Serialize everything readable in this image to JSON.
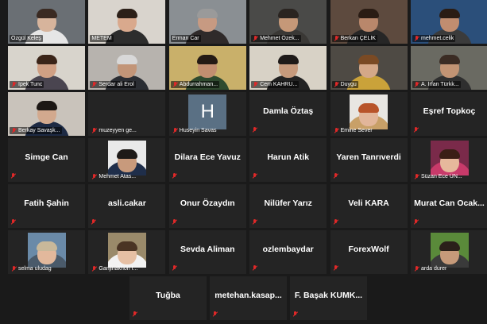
{
  "meeting": {
    "participants": [
      {
        "name": "Özgül Keleş",
        "tag": "Özgül Keleş",
        "video": true,
        "muted": false,
        "palette": [
          "#6a6f74",
          "#d7b49c",
          "#3a2a22",
          "#e6e6e6"
        ]
      },
      {
        "name": "METEM",
        "tag": "METEM",
        "video": true,
        "muted": false,
        "speaking": true,
        "palette": [
          "#d9d4cd",
          "#d9a98d",
          "#2c2018",
          "#2d2d2d"
        ]
      },
      {
        "name": "Erman Car",
        "tag": "Erman Car",
        "video": true,
        "muted": false,
        "palette": [
          "#8a8f93",
          "#c79a82",
          "#9a9a9a",
          "#2f2a2a"
        ]
      },
      {
        "name": "Mehmet Özek",
        "tag": "Mehmet Özek...",
        "video": true,
        "muted": true,
        "palette": [
          "#4a4a48",
          "#c59878",
          "#2a2420",
          "#3a3835"
        ]
      },
      {
        "name": "Berkan ÇELİK",
        "tag": "Berkan ÇELİK",
        "video": true,
        "muted": true,
        "palette": [
          "#5d4a3e",
          "#b9876b",
          "#2a1c14",
          "#262626"
        ]
      },
      {
        "name": "mehmet.celik",
        "tag": "mehmet.celik",
        "video": true,
        "muted": true,
        "palette": [
          "#2b4f7a",
          "#c08d70",
          "#2a1c14",
          "#3b3b3b"
        ]
      },
      {
        "name": "Ipek Tunc",
        "tag": "Ipek Tunc",
        "video": true,
        "muted": true,
        "palette": [
          "#d8d4cc",
          "#d0a084",
          "#3a2418",
          "#4a4550"
        ]
      },
      {
        "name": "Serdar ali Erol",
        "tag": "Serdar ali Erol",
        "video": true,
        "muted": true,
        "palette": [
          "#b7b3ae",
          "#c29578",
          "#d8d8d8",
          "#2a2d33"
        ]
      },
      {
        "name": "Abdurrahman",
        "tag": "Abdurrahman...",
        "video": true,
        "muted": true,
        "palette": [
          "#c9b06a",
          "#c28e70",
          "#241a14",
          "#2f4a2f"
        ]
      },
      {
        "name": "Cem KAHRU",
        "tag": "Cem KAHRU...",
        "video": true,
        "muted": true,
        "palette": [
          "#d8d2c6",
          "#c69a7c",
          "#1e1a18",
          "#222222"
        ]
      },
      {
        "name": "Duygu",
        "tag": "Duygu",
        "video": true,
        "muted": true,
        "palette": [
          "#4e4a44",
          "#d4a888",
          "#7a4a24",
          "#caa23a"
        ]
      },
      {
        "name": "A. İrfan Türkk",
        "tag": "A. İrfan Türkk...",
        "video": true,
        "muted": true,
        "palette": [
          "#6a6a62",
          "#c29474",
          "#3b2c24",
          "#2f2f2f"
        ]
      },
      {
        "name": "Berkay Savaşk",
        "tag": "Berkay Savaşk...",
        "video": true,
        "muted": true,
        "palette": [
          "#c9c3bb",
          "#d2a98e",
          "#1c1714",
          "#1d2a44"
        ]
      },
      {
        "name": "muzeyyen ge",
        "tag": "muzeyyen ge...",
        "video": false,
        "muted": true,
        "display": "empty"
      },
      {
        "name": "Huseyin Savas",
        "tag": "Huseyin Savas",
        "video": false,
        "muted": true,
        "display": "letter",
        "letter": "H"
      },
      {
        "name": "Damla Öztaş",
        "tag": "",
        "video": false,
        "muted": true,
        "display": "name"
      },
      {
        "name": "Emine Sever",
        "tag": "Emine Sever",
        "video": false,
        "muted": true,
        "display": "photo",
        "palette": [
          "#e8e6e2",
          "#e2b69a",
          "#b8542a",
          "#c8a068"
        ]
      },
      {
        "name": "Eşref Topkoç",
        "tag": "",
        "video": false,
        "muted": true,
        "display": "name"
      },
      {
        "name": "Simge Can",
        "tag": "",
        "video": false,
        "muted": true,
        "display": "name"
      },
      {
        "name": "Mehmet Atas",
        "tag": "Mehmet Atas...",
        "video": false,
        "muted": true,
        "display": "photo",
        "palette": [
          "#e9e9e9",
          "#c89a7c",
          "#1e1a18",
          "#1f2e4a"
        ]
      },
      {
        "name": "Dilara Ece Yavuz",
        "tag": "",
        "video": false,
        "muted": true,
        "display": "name"
      },
      {
        "name": "Harun Atik",
        "tag": "",
        "video": false,
        "muted": true,
        "display": "name"
      },
      {
        "name": "Yaren Tanrıverdi",
        "tag": "",
        "video": false,
        "muted": true,
        "display": "name"
      },
      {
        "name": "Süzan Ece ÜN",
        "tag": "Süzan Ece ÜN...",
        "video": false,
        "muted": true,
        "display": "photo",
        "palette": [
          "#7a2a4a",
          "#e6b89c",
          "#3a1e16",
          "#c83a6a"
        ]
      },
      {
        "name": "Fatih Şahin",
        "tag": "",
        "video": false,
        "muted": true,
        "display": "name"
      },
      {
        "name": "asli.cakar",
        "tag": "",
        "video": false,
        "muted": true,
        "display": "name"
      },
      {
        "name": "Onur Özaydın",
        "tag": "",
        "video": false,
        "muted": true,
        "display": "name"
      },
      {
        "name": "Nilüfer Yarız",
        "tag": "",
        "video": false,
        "muted": true,
        "display": "name"
      },
      {
        "name": "Veli KARA",
        "tag": "",
        "video": false,
        "muted": true,
        "display": "name"
      },
      {
        "name": "Murat Can Ocak...",
        "tag": "",
        "video": false,
        "muted": true,
        "display": "name"
      },
      {
        "name": "selma uludag",
        "tag": "selma uludag",
        "video": false,
        "muted": true,
        "display": "photo",
        "palette": [
          "#6a8aa8",
          "#e2b89c",
          "#c8b89a",
          "#4a5a6a"
        ]
      },
      {
        "name": "Ganjinakhon I",
        "tag": "Ganjinakhon I...",
        "video": false,
        "muted": true,
        "display": "photo",
        "palette": [
          "#9a8a6a",
          "#e6c0a4",
          "#4a3424",
          "#f2f2f2"
        ]
      },
      {
        "name": "Sevda Aliman",
        "tag": "",
        "video": false,
        "muted": true,
        "display": "name"
      },
      {
        "name": "ozlembaydar",
        "tag": "",
        "video": false,
        "muted": true,
        "display": "name"
      },
      {
        "name": "ForexWolf",
        "tag": "",
        "video": false,
        "muted": true,
        "display": "name"
      },
      {
        "name": "arda durer",
        "tag": "arda durer",
        "video": false,
        "muted": true,
        "display": "photo",
        "palette": [
          "#5a8a3a",
          "#c69a7a",
          "#2a201a",
          "#3a3a3a"
        ]
      },
      {
        "name": "Tuğba",
        "tag": "",
        "video": false,
        "muted": true,
        "display": "name"
      },
      {
        "name": "metehan.kasap...",
        "tag": "",
        "video": false,
        "muted": true,
        "display": "name"
      },
      {
        "name": "F. Başak KUMK...",
        "tag": "",
        "video": false,
        "muted": true,
        "display": "name"
      }
    ]
  }
}
